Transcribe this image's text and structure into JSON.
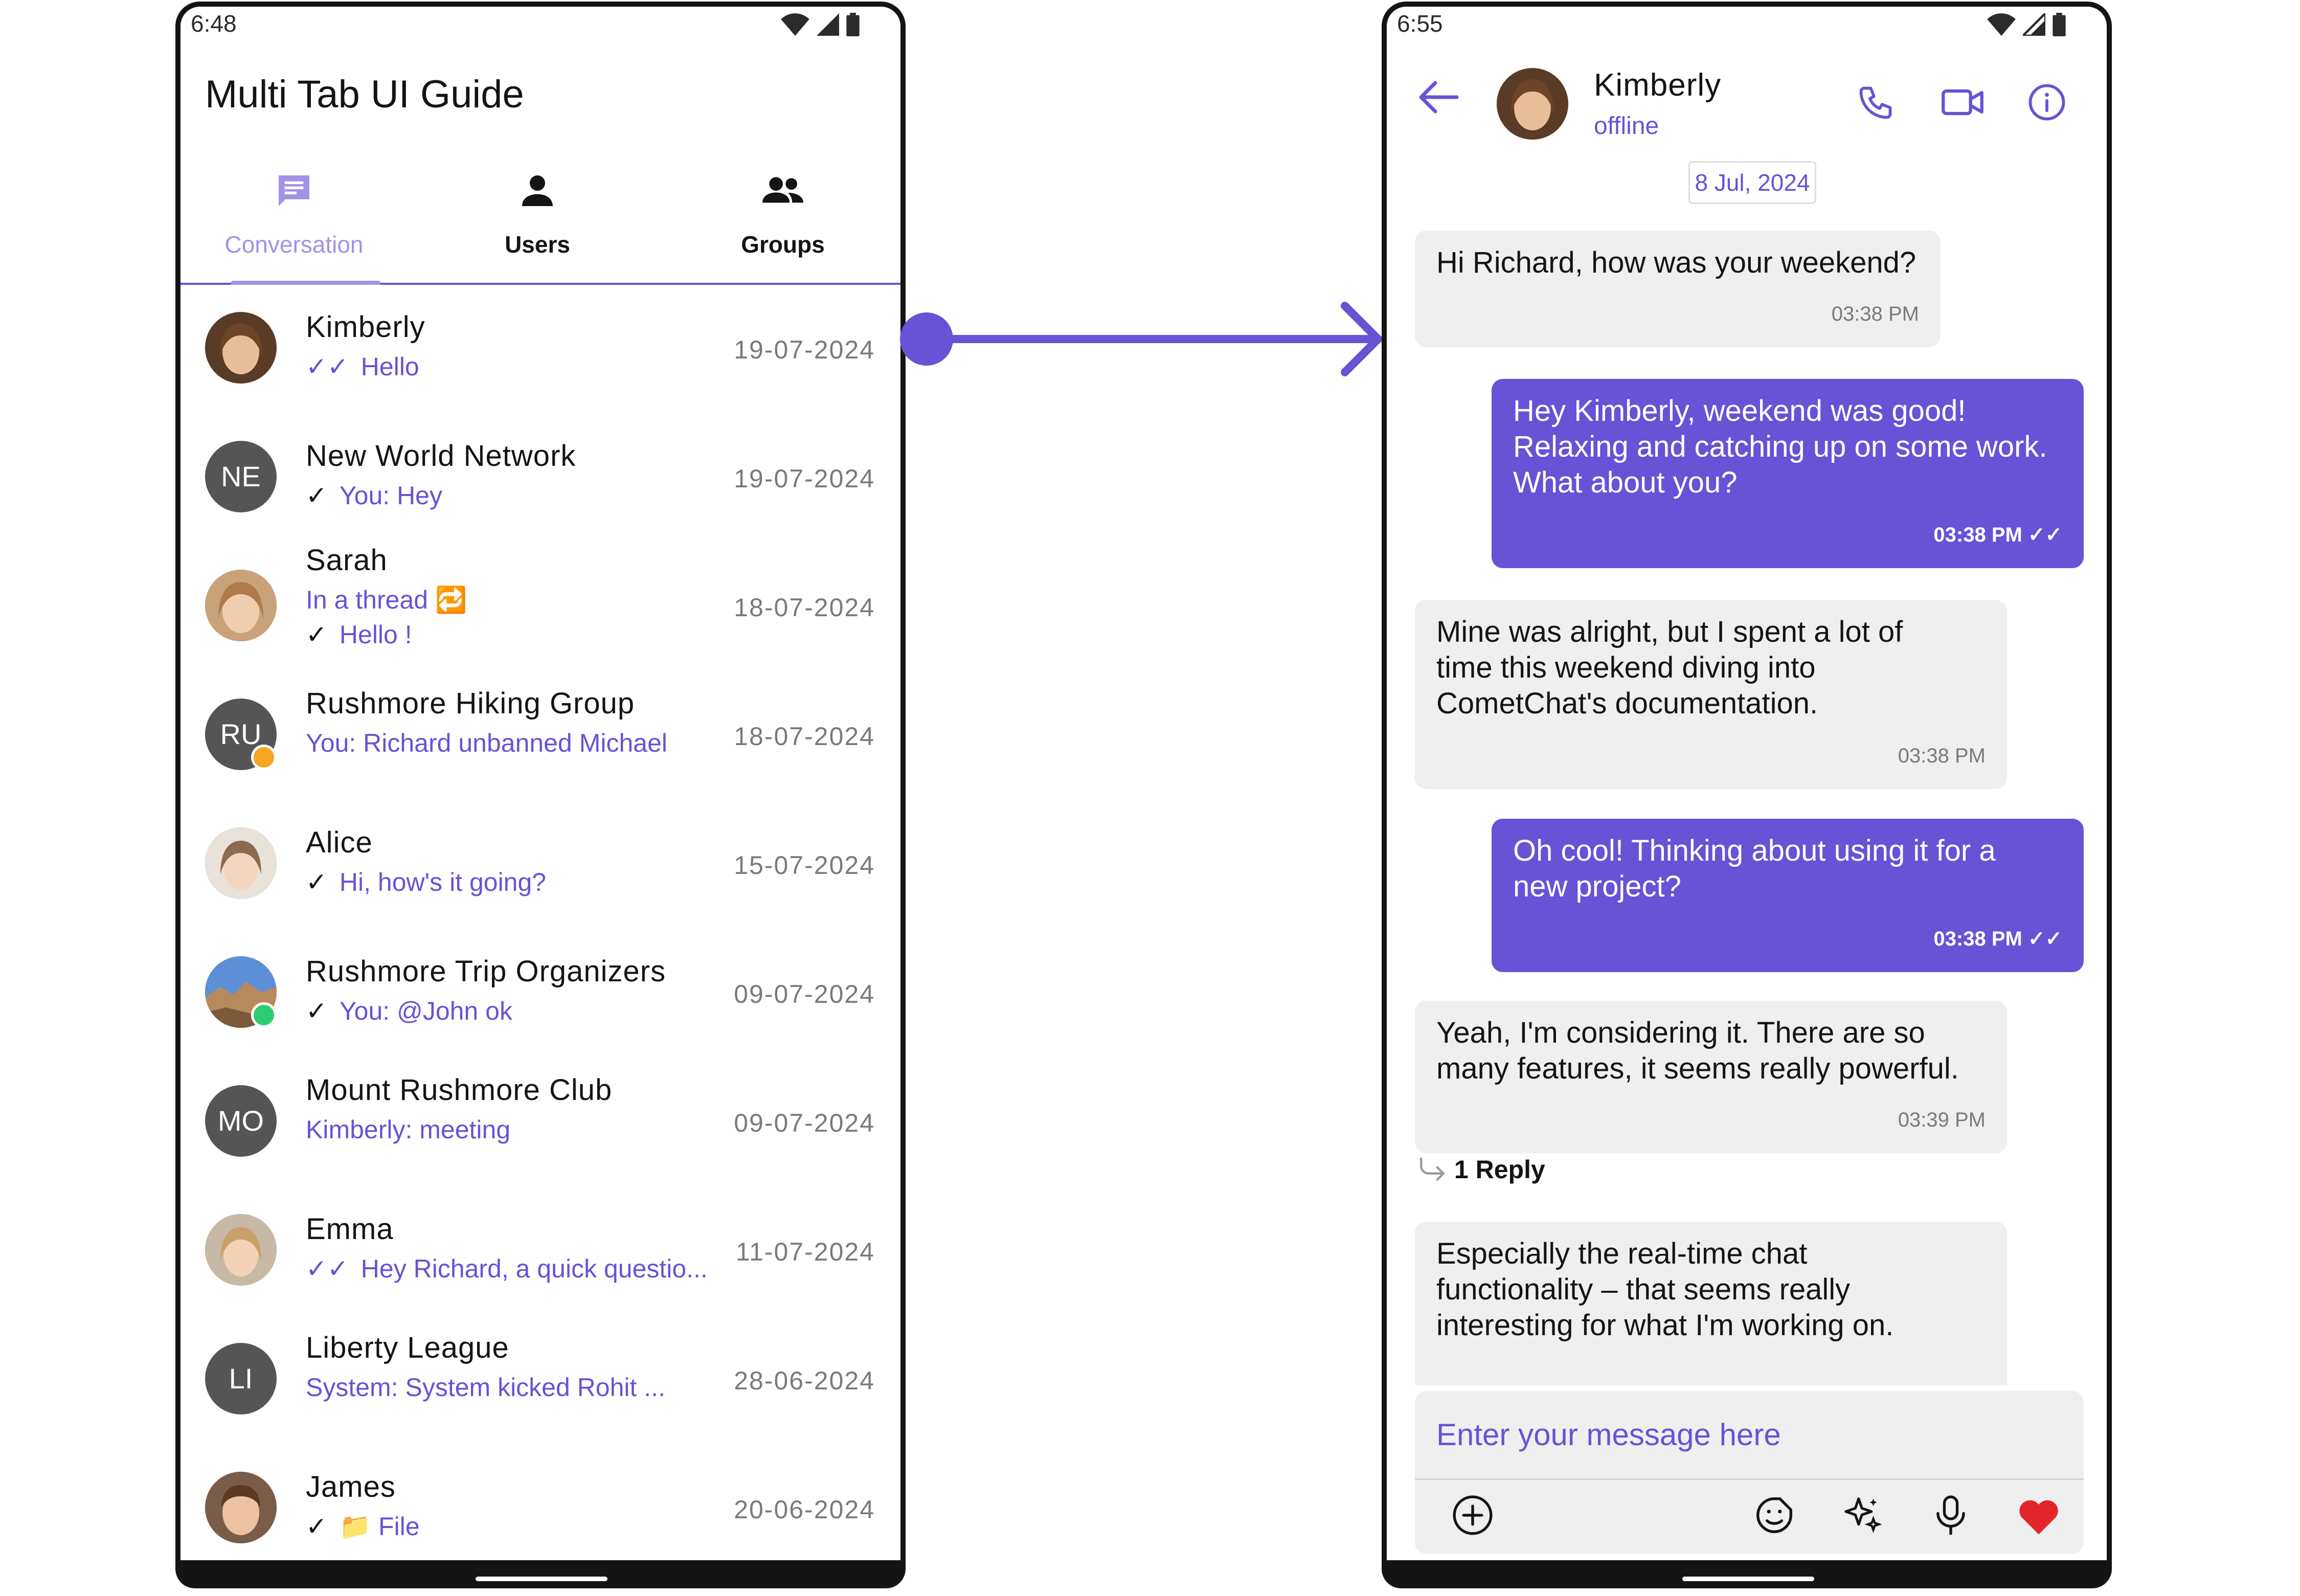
{
  "left_screen": {
    "status_time": "6:48",
    "app_title": "Multi Tab UI Guide",
    "tabs": [
      {
        "label": "Conversation",
        "icon": "chat-icon",
        "active": true
      },
      {
        "label": "Users",
        "icon": "person-icon",
        "active": false
      },
      {
        "label": "Groups",
        "icon": "group-icon",
        "active": false
      }
    ],
    "conversations": [
      {
        "name": "Kimberly",
        "receipt": "✓✓",
        "preview": "Hello",
        "date": "19-07-2024",
        "avatar": "photo"
      },
      {
        "name": "New World Network",
        "receipt": "✓",
        "preview": "You: Hey",
        "date": "19-07-2024",
        "initials": "NE"
      },
      {
        "name": "Sarah",
        "thread": "In a thread 🔁",
        "receipt": "✓",
        "preview": "Hello !",
        "date": "18-07-2024",
        "avatar": "photo"
      },
      {
        "name": "Rushmore Hiking Group",
        "preview": "You: Richard unbanned Michael",
        "date": "18-07-2024",
        "initials": "RU"
      },
      {
        "name": "Alice",
        "receipt": "✓",
        "preview": "Hi, how's it going?",
        "date": "15-07-2024",
        "avatar": "photo"
      },
      {
        "name": "Rushmore Trip Organizers",
        "receipt": "✓",
        "preview": "You: @John ok",
        "date": "09-07-2024",
        "avatar": "photo"
      },
      {
        "name": "Mount Rushmore Club",
        "preview": "Kimberly: meeting",
        "date": "09-07-2024",
        "initials": "MO"
      },
      {
        "name": "Emma",
        "receipt": "✓✓",
        "preview": "Hey Richard, a quick questio...",
        "date": "11-07-2024",
        "avatar": "photo"
      },
      {
        "name": "Liberty League",
        "preview": "System: System kicked Rohit ...",
        "date": "28-06-2024",
        "initials": "LI"
      },
      {
        "name": "James",
        "receipt": "✓",
        "preview": "📁 File",
        "date": "20-06-2024",
        "avatar": "photo"
      }
    ]
  },
  "right_screen": {
    "status_time": "6:55",
    "contact_name": "Kimberly",
    "contact_status": "offline",
    "date_separator": "8 Jul, 2024",
    "messages": [
      {
        "direction": "in",
        "text": "Hi Richard, how was your weekend?",
        "time": "03:38 PM"
      },
      {
        "direction": "out",
        "text": "Hey Kimberly, weekend was good!\nRelaxing and catching up on some work.\nWhat about you?",
        "time": "03:38 PM"
      },
      {
        "direction": "in",
        "text": "Mine was alright, but I spent a lot of\ntime this weekend diving into\nCometChat's documentation.",
        "time": "03:38 PM"
      },
      {
        "direction": "out",
        "text": "Oh cool! Thinking about using it for a\nnew project?",
        "time": "03:38 PM"
      },
      {
        "direction": "in",
        "text": "Yeah, I'm considering it.  There are so\nmany features, it seems really powerful.",
        "time": "03:39 PM"
      },
      {
        "direction": "in",
        "text": "Especially the real-time chat\nfunctionality – that seems really\ninteresting for what I'm working on."
      }
    ],
    "reply_count": "1 Reply",
    "composer_placeholder": "Enter your message here"
  },
  "colors": {
    "accent": "#6852d6",
    "accent_light": "#a391e8",
    "bubble_in": "#efefef",
    "avatar_gray": "#555555",
    "heart": "#e3242b",
    "badge_orange": "#f5a623",
    "badge_green": "#2ecc71"
  }
}
